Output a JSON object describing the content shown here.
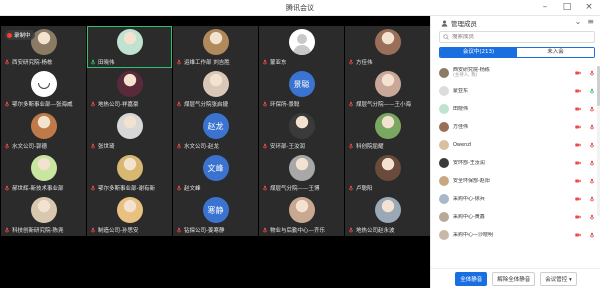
{
  "window": {
    "title": "腾讯会议"
  },
  "recording": {
    "label": "录制中"
  },
  "tiles": [
    {
      "name": "西安研究院-杨栋",
      "mic": "red",
      "avatar": "photo",
      "color": "#8b7a64"
    },
    {
      "name": "田晓伟",
      "mic": "green",
      "avatar": "photo",
      "color": "#bfe3d0",
      "active": true
    },
    {
      "name": "运维工作部 刘吉胜",
      "mic": "red",
      "avatar": "photo",
      "color": "#b08a5a"
    },
    {
      "name": "蒙亚东",
      "mic": "red",
      "avatar": "person",
      "color": "#ffffff"
    },
    {
      "name": "方佳伟",
      "mic": "red",
      "avatar": "photo",
      "color": "#9a6f5a"
    },
    {
      "name": "鄂尔多斯事业部—张海威",
      "mic": "red",
      "avatar": "smile",
      "color": "#ffffff"
    },
    {
      "name": "地热公司-祥嘉豪",
      "mic": "red",
      "avatar": "photo",
      "color": "#5a2a3a"
    },
    {
      "name": "煤层气分院张启捷",
      "mic": "red",
      "avatar": "photo",
      "color": "#d9c8b8"
    },
    {
      "name": "环保所-景聪",
      "mic": "red",
      "avatar": "text",
      "avatarText": "景聪",
      "color": "#3b73d0"
    },
    {
      "name": "煤层气分院——王小海",
      "mic": "red",
      "avatar": "photo",
      "color": "#c9a89a"
    },
    {
      "name": "水文公司-郭德",
      "mic": "red",
      "avatar": "photo",
      "color": "#c07a4a"
    },
    {
      "name": "张世琦",
      "mic": "red",
      "avatar": "photo",
      "color": "#d8d8d8"
    },
    {
      "name": "水文公司-赵龙",
      "mic": "red",
      "avatar": "text",
      "avatarText": "赵龙",
      "color": "#3b73d0"
    },
    {
      "name": "安环部-王汝润",
      "mic": "red",
      "avatar": "photo",
      "color": "#3a3a3a"
    },
    {
      "name": "科创院屈耀",
      "mic": "red",
      "avatar": "photo",
      "color": "#7aa862"
    },
    {
      "name": "郝世辉-新技术事业部",
      "mic": "red",
      "avatar": "photo",
      "color": "#c8e6a0"
    },
    {
      "name": "鄂尔多斯事业部-谢有新",
      "mic": "red",
      "avatar": "photo",
      "color": "#d8b870"
    },
    {
      "name": "赵文峰",
      "mic": "red",
      "avatar": "text",
      "avatarText": "文峰",
      "color": "#3b73d0"
    },
    {
      "name": "煤层气分院——王博",
      "mic": "red",
      "avatar": "photo",
      "color": "#a8a8a8"
    },
    {
      "name": "卢聪阳",
      "mic": "red",
      "avatar": "photo",
      "color": "#6a4a3a"
    },
    {
      "name": "科技创新研究院-陈尧",
      "mic": "red",
      "avatar": "photo",
      "color": "#d8c8b0"
    },
    {
      "name": "制造公司-孙思安",
      "mic": "red",
      "avatar": "photo",
      "color": "#e8c080"
    },
    {
      "name": "钻探公司-姜寒静",
      "mic": "red",
      "avatar": "text",
      "avatarText": "寒静",
      "color": "#3b73d0"
    },
    {
      "name": "物业与后勤中心—齐乐",
      "mic": "red",
      "avatar": "photo",
      "color": "#c8a890"
    },
    {
      "name": "地热公司赵永波",
      "mic": "red",
      "avatar": "photo",
      "color": "#9aa8b8"
    }
  ],
  "panel": {
    "title": "管理成员",
    "search_placeholder": "搜索成员",
    "tabs": [
      {
        "label": "会议中(213)",
        "active": true
      },
      {
        "label": "未入会",
        "active": false
      }
    ],
    "members": [
      {
        "name": "西安研究院-杨栋",
        "sub": "(主持人, 我)",
        "color": "#8b7a64",
        "video": "red",
        "mic": "red"
      },
      {
        "name": "蒙亚东",
        "sub": "",
        "color": "#dcdcdc",
        "video": "red",
        "mic": "green"
      },
      {
        "name": "田晓伟",
        "sub": "",
        "color": "#bfe3d0",
        "video": "red",
        "mic": "red"
      },
      {
        "name": "方佳伟",
        "sub": "",
        "color": "#9a6f5a",
        "video": "red",
        "mic": "red"
      },
      {
        "name": "Owenzl",
        "sub": "",
        "color": "#d8c0a0",
        "video": "red",
        "mic": "red"
      },
      {
        "name": "安环部-王汝润",
        "sub": "",
        "color": "#3a3a3a",
        "video": "red",
        "mic": "red"
      },
      {
        "name": "安全环保部-赵阳",
        "sub": "",
        "color": "#c8a880",
        "video": "red",
        "mic": "red"
      },
      {
        "name": "采购中心-徐兵",
        "sub": "",
        "color": "#a8b8c8",
        "video": "red",
        "mic": "red"
      },
      {
        "name": "采购中心-黄鑫",
        "sub": "",
        "color": "#b8a898",
        "video": "red",
        "mic": "red"
      },
      {
        "name": "采购中心—沙晓明",
        "sub": "",
        "color": "#c8b8a8",
        "video": "red",
        "mic": "red"
      }
    ],
    "buttons": {
      "mute_all": "全体静音",
      "unmute_all": "解除全体静音",
      "manage": "会议管控"
    }
  },
  "colors": {
    "mic_red": "#e84a4a",
    "mic_green": "#35c16b",
    "accent": "#1a6fe0"
  }
}
